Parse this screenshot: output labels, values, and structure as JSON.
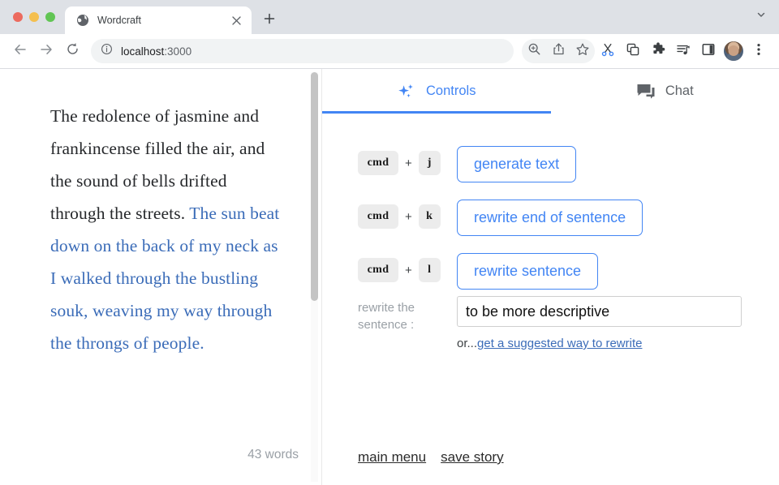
{
  "browser": {
    "tab": {
      "title": "Wordcraft",
      "favicon_icon": "globe-icon",
      "close_icon": "close-icon"
    },
    "new_tab_icon": "plus-icon",
    "tabstrip_menu_icon": "chevron-down-icon",
    "nav": {
      "back_icon": "arrow-left-icon",
      "forward_icon": "arrow-right-icon",
      "reload_icon": "reload-icon"
    },
    "omnibox": {
      "info_icon": "info-circle-icon",
      "host": "localhost",
      "port": ":3000",
      "full_url": "localhost:3000"
    },
    "toolbar_icons": [
      "zoom-icon",
      "share-icon",
      "bookmark-star-icon",
      "scissors-icon",
      "copy-icon",
      "extensions-puzzle-icon",
      "reading-list-icon",
      "side-panel-icon"
    ],
    "avatar_name": "profile-avatar",
    "menu_icon": "kebab-menu-icon",
    "accent_blue": "#4285f4",
    "scissors_blue": "#4285f4"
  },
  "editor": {
    "story_plain": " The redolence of jasmine and frankincense filled the air, and the sound of bells drifted through the streets. ",
    "story_highlight": "The sun beat down on the back of my neck as I walked through the bustling souk, weaving my way through the throngs of people.",
    "highlight_color": "#3b6cb8",
    "word_count": "43 words",
    "scrollbar_name": "editor-scrollbar"
  },
  "panel": {
    "tabs": [
      {
        "label": "Controls",
        "icon": "sparkle-icon",
        "active": true
      },
      {
        "label": "Chat",
        "icon": "chat-bubble-icon",
        "active": false
      }
    ],
    "operations": [
      {
        "key_mod": "cmd",
        "key_plus": "+",
        "key_letter": "j",
        "button_label": "generate text"
      },
      {
        "key_mod": "cmd",
        "key_plus": "+",
        "key_letter": "k",
        "button_label": "rewrite end of sentence"
      },
      {
        "key_mod": "cmd",
        "key_plus": "+",
        "key_letter": "l",
        "button_label": "rewrite sentence"
      }
    ],
    "prompt": {
      "label": "rewrite the sentence :",
      "value": "to be more descriptive",
      "placeholder": "",
      "or_prefix": "or...",
      "or_link": "get a suggested way to rewrite"
    },
    "footer": [
      {
        "label": "main menu"
      },
      {
        "label": "save story"
      }
    ]
  }
}
